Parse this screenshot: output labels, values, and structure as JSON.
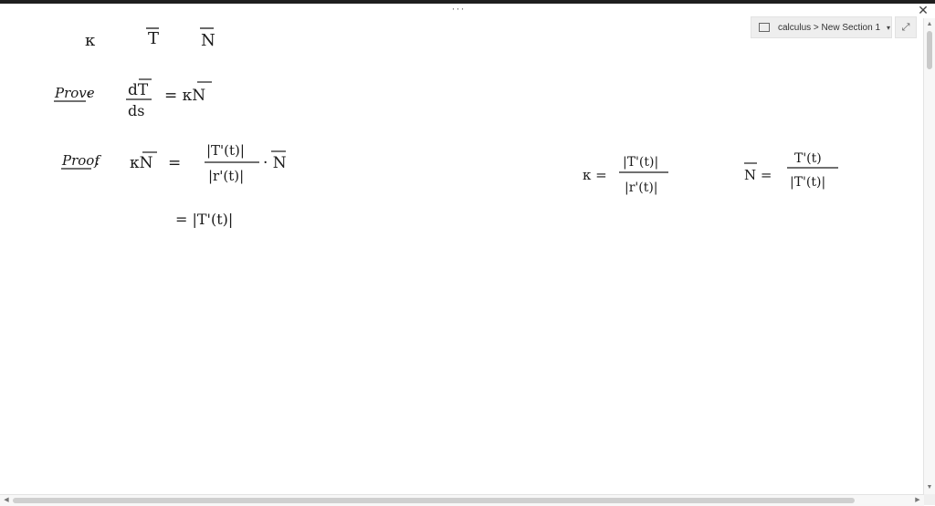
{
  "window": {
    "menu_dots": "···",
    "close_glyph": "✕"
  },
  "breadcrumb": {
    "notebook": "calculus",
    "separator": ">",
    "section": "New Section 1",
    "dropdown_glyph": "▾",
    "expand_glyph": "⤢"
  },
  "ink": {
    "header_symbols": [
      "κ",
      "T",
      "N"
    ],
    "prove_label": "Prove",
    "prove_lhs_num": "dT",
    "prove_lhs_den": "ds",
    "prove_rhs": "= κN",
    "proof_label": "Proof",
    "proof_colon": ":",
    "proof_lhs": "κN",
    "proof_eq": "=",
    "proof_frac_num": "|T'(t)|",
    "proof_frac_den": "|r'(t)|",
    "proof_dot_N": "· N",
    "proof_line2": "= |T'(t)|",
    "kappa_def_lhs": "κ =",
    "kappa_def_num": "|T'(t)|",
    "kappa_def_den": "|r'(t)|",
    "N_def_lhs": "N =",
    "N_def_num": "T'(t)",
    "N_def_den": "|T'(t)|"
  },
  "scrollbars": {
    "up": "▲",
    "down": "▼",
    "left": "◀",
    "right": "▶"
  }
}
